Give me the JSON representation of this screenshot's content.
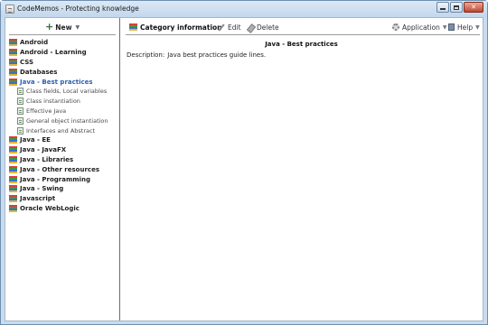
{
  "window": {
    "title": "CodeMemos - Protecting knowledge"
  },
  "sidebar": {
    "new_label": "New",
    "categories": [
      {
        "label": "Android"
      },
      {
        "label": "Android - Learning"
      },
      {
        "label": "CSS"
      },
      {
        "label": "Databases"
      },
      {
        "label": "Java - Best practices",
        "selected": true,
        "children": [
          {
            "label": "Class fields, Local variables"
          },
          {
            "label": "Class instantiation"
          },
          {
            "label": "Effective Java"
          },
          {
            "label": "General object instantiation"
          },
          {
            "label": "Interfaces and Abstract"
          }
        ]
      },
      {
        "label": "Java - EE"
      },
      {
        "label": "Java - JavaFX"
      },
      {
        "label": "Java - Libraries"
      },
      {
        "label": "Java - Other resources"
      },
      {
        "label": "Java - Programming"
      },
      {
        "label": "Java - Swing"
      },
      {
        "label": "Javascript"
      },
      {
        "label": "Oracle WebLogic"
      }
    ]
  },
  "toolbar": {
    "category_info_label": "Category information",
    "edit_label": "Edit",
    "delete_label": "Delete",
    "application_label": "Application",
    "help_label": "Help"
  },
  "detail": {
    "title": "Java - Best practices",
    "description_label": "Description:",
    "description_value": "Java best practices guide lines."
  },
  "colors": {
    "window_frame": "#c9dcef",
    "selected_text": "#2e5fb0",
    "close_button": "#c2462e"
  }
}
